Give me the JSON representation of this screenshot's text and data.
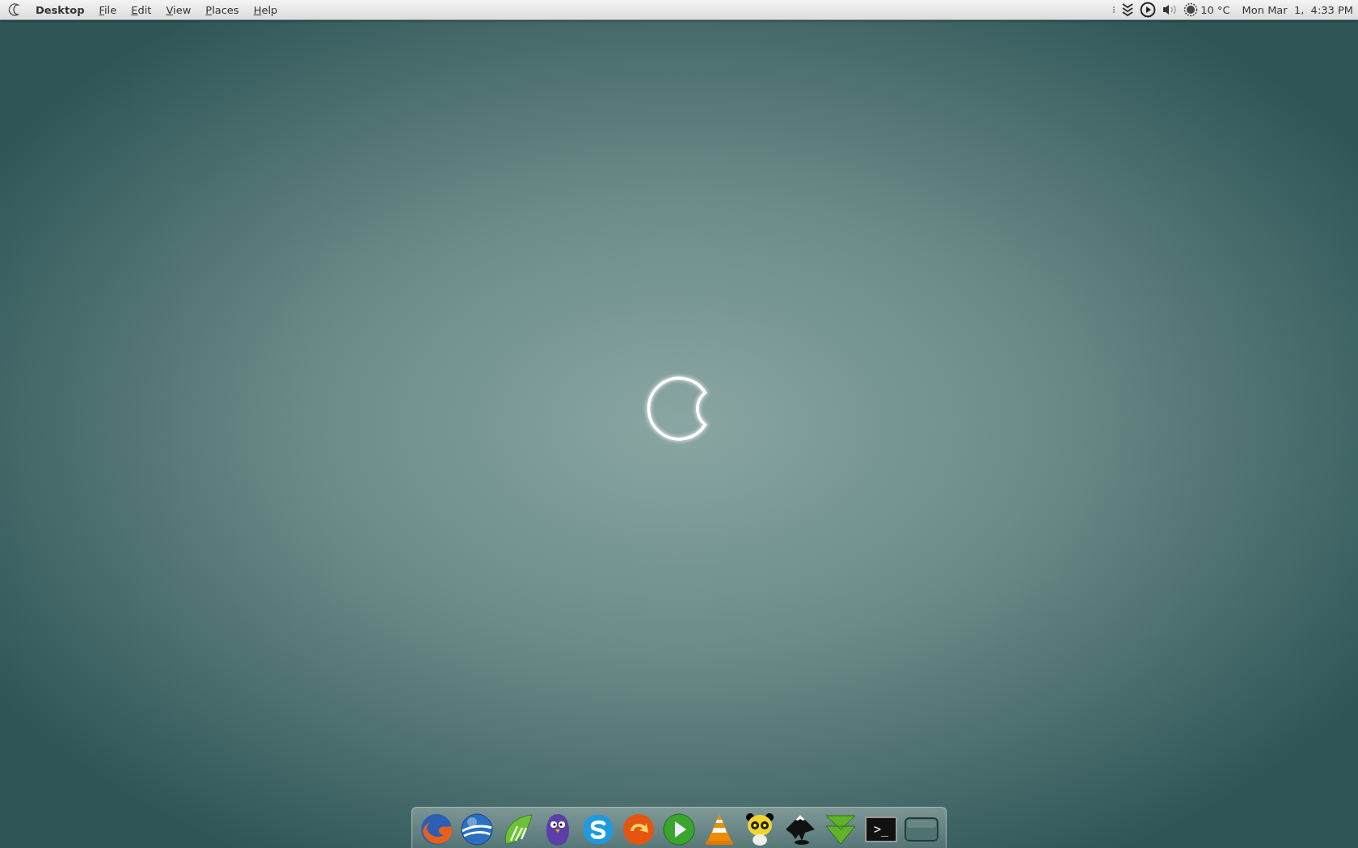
{
  "top_panel": {
    "app_name": "Desktop",
    "menus": [
      "File",
      "Edit",
      "View",
      "Places",
      "Help"
    ],
    "tray": {
      "weather": "10 °C",
      "clock": "Mon Mar  1,  4:33 PM"
    }
  },
  "dock": {
    "items": [
      {
        "kind": "browser-globe"
      },
      {
        "kind": "blue-globe"
      },
      {
        "kind": "green-leaf"
      },
      {
        "kind": "purple-bird"
      },
      {
        "kind": "s-bubble"
      },
      {
        "kind": "orange-arrow"
      },
      {
        "kind": "play-circle"
      },
      {
        "kind": "cone"
      },
      {
        "kind": "panda"
      },
      {
        "kind": "ink-mountain"
      },
      {
        "kind": "down-arrow"
      },
      {
        "kind": "terminal",
        "label": ">_"
      },
      {
        "kind": "screen"
      }
    ]
  }
}
